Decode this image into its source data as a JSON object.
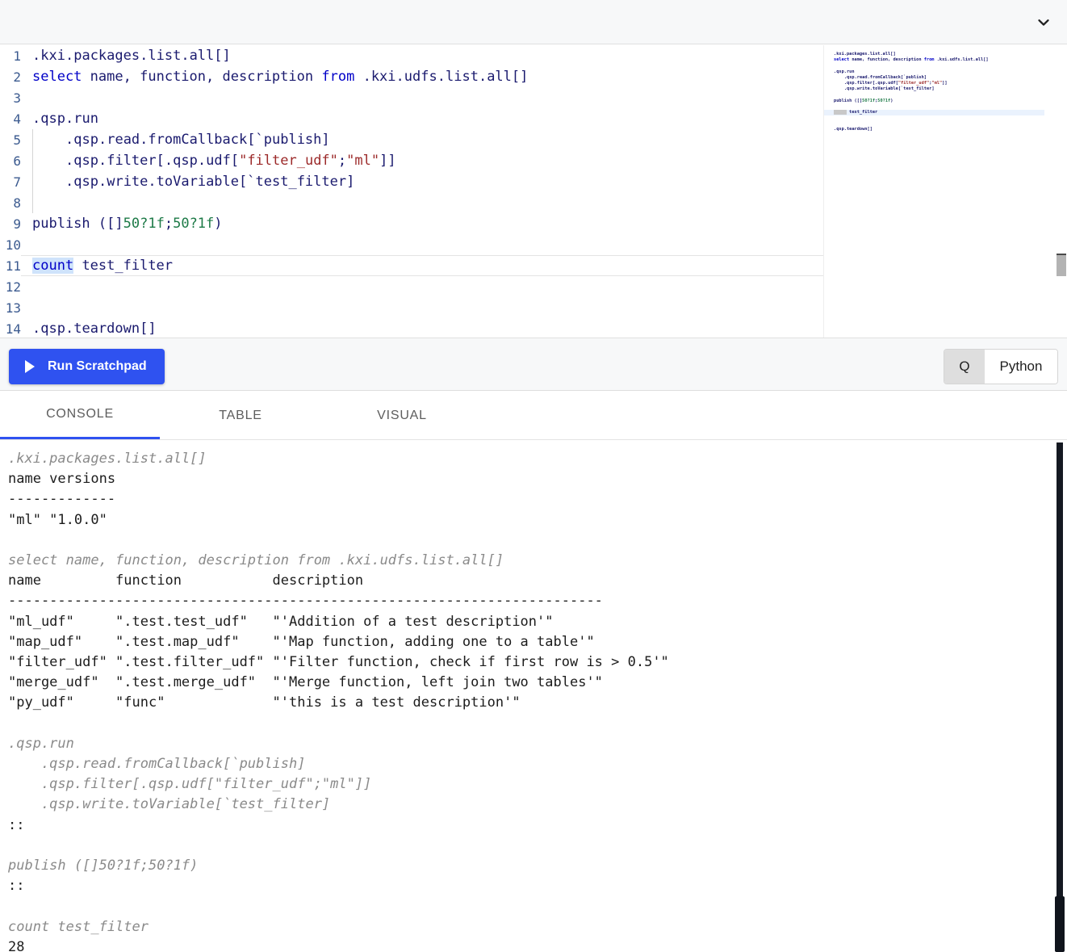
{
  "topbar": {
    "collapse_icon": "chevron-down-icon"
  },
  "editor": {
    "language": "q",
    "current_line": 11,
    "selection_text": "count",
    "lines": [
      {
        "n": "1",
        "text": ".kxi.packages.list.all[]"
      },
      {
        "n": "2",
        "text": "select name, function, description from .kxi.udfs.list.all[]"
      },
      {
        "n": "3",
        "text": ""
      },
      {
        "n": "4",
        "text": ".qsp.run"
      },
      {
        "n": "5",
        "text": "    .qsp.read.fromCallback[`publish]"
      },
      {
        "n": "6",
        "text": "    .qsp.filter[.qsp.udf[\"filter_udf\";\"ml\"]]"
      },
      {
        "n": "7",
        "text": "    .qsp.write.toVariable[`test_filter]"
      },
      {
        "n": "8",
        "text": ""
      },
      {
        "n": "9",
        "text": "publish ([]50?1f;50?1f)"
      },
      {
        "n": "10",
        "text": ""
      },
      {
        "n": "11",
        "text": "count test_filter"
      },
      {
        "n": "12",
        "text": ""
      },
      {
        "n": "13",
        "text": ""
      },
      {
        "n": "14",
        "text": ".qsp.teardown[]"
      }
    ]
  },
  "minimap": {
    "lines": [
      ".kxi.packages.list.all[]",
      "select name, function, description from .kxi.udfs.list.all[]",
      "",
      ".qsp.run",
      "    .qsp.read.fromCallback[`publish]",
      "    .qsp.filter[.qsp.udf[\"filter_udf\";\"ml\"]]",
      "    .qsp.write.toVariable[`test_filter]",
      "",
      "publish ([]50?1f;50?1f)",
      "",
      "count test_filter",
      "",
      "",
      ".qsp.teardown[]"
    ]
  },
  "runbar": {
    "run_label": "Run Scratchpad",
    "play_icon": "play-icon",
    "language_options": [
      "Q",
      "Python"
    ],
    "language_selected": "Q"
  },
  "tabs": {
    "items": [
      "CONSOLE",
      "TABLE",
      "VISUAL"
    ],
    "active": "CONSOLE"
  },
  "console": {
    "lines": [
      {
        "kind": "echo",
        "text": ".kxi.packages.list.all[]"
      },
      {
        "kind": "output",
        "text": "name versions"
      },
      {
        "kind": "output",
        "text": "-------------"
      },
      {
        "kind": "output",
        "text": "\"ml\" \"1.0.0\""
      },
      {
        "kind": "blank",
        "text": ""
      },
      {
        "kind": "echo",
        "text": "select name, function, description from .kxi.udfs.list.all[]"
      },
      {
        "kind": "output",
        "text": "name         function           description"
      },
      {
        "kind": "output",
        "text": "------------------------------------------------------------------------"
      },
      {
        "kind": "output",
        "text": "\"ml_udf\"     \".test.test_udf\"   \"'Addition of a test description'\""
      },
      {
        "kind": "output",
        "text": "\"map_udf\"    \".test.map_udf\"    \"'Map function, adding one to a table'\""
      },
      {
        "kind": "output",
        "text": "\"filter_udf\" \".test.filter_udf\" \"'Filter function, check if first row is > 0.5'\""
      },
      {
        "kind": "output",
        "text": "\"merge_udf\"  \".test.merge_udf\"  \"'Merge function, left join two tables'\""
      },
      {
        "kind": "output",
        "text": "\"py_udf\"     \"func\"             \"'this is a test description'\""
      },
      {
        "kind": "blank",
        "text": ""
      },
      {
        "kind": "echo",
        "text": ".qsp.run"
      },
      {
        "kind": "echo",
        "text": "    .qsp.read.fromCallback[`publish]"
      },
      {
        "kind": "echo",
        "text": "    .qsp.filter[.qsp.udf[\"filter_udf\";\"ml\"]]"
      },
      {
        "kind": "echo",
        "text": "    .qsp.write.toVariable[`test_filter]"
      },
      {
        "kind": "output",
        "text": "::"
      },
      {
        "kind": "blank",
        "text": ""
      },
      {
        "kind": "echo",
        "text": "publish ([]50?1f;50?1f)"
      },
      {
        "kind": "output",
        "text": "::"
      },
      {
        "kind": "blank",
        "text": ""
      },
      {
        "kind": "echo",
        "text": "count test_filter"
      },
      {
        "kind": "output",
        "text": "28"
      }
    ]
  },
  "colors": {
    "accent": "#2f52f0",
    "keyword": "#0000c8",
    "string": "#9c2a2a",
    "number": "#1d7a47",
    "identifier": "#1a1a6e",
    "selection": "#cfe3fb",
    "echo_text": "#8a8a8a"
  }
}
